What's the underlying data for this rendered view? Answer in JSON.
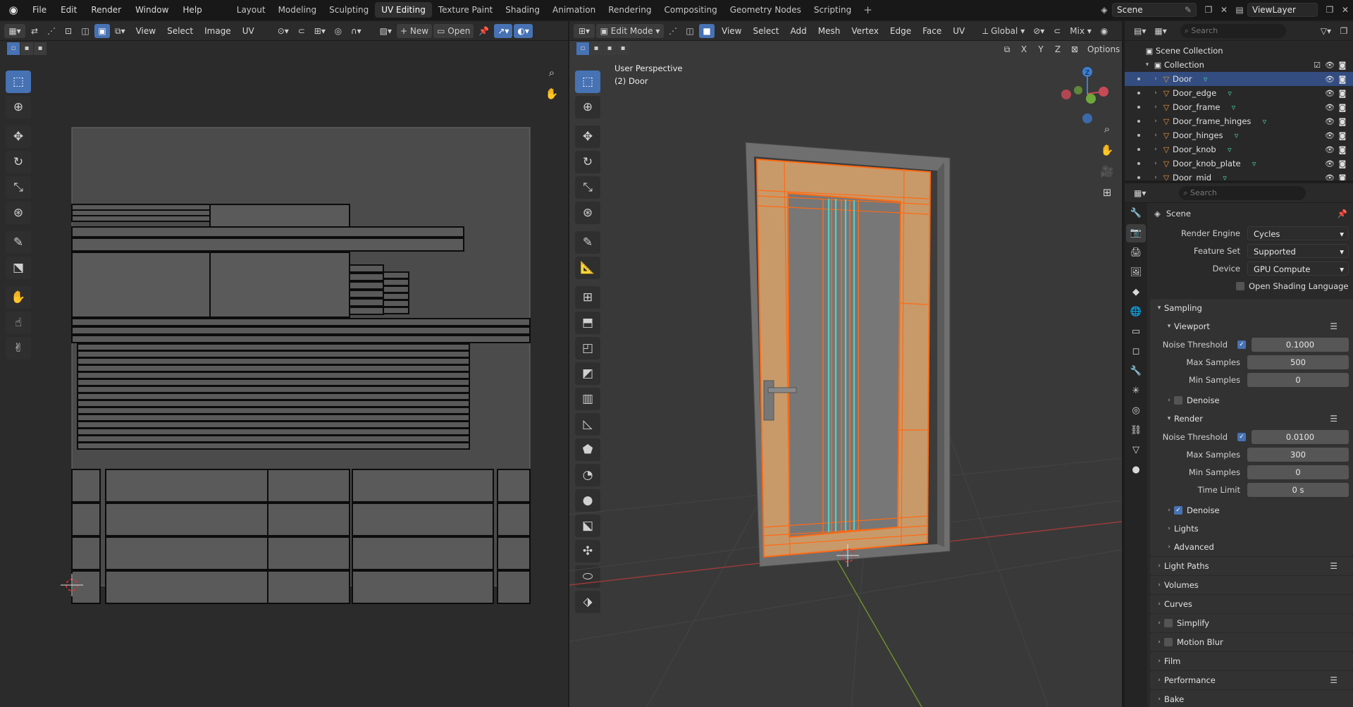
{
  "topbar": {
    "menus": [
      "File",
      "Edit",
      "Render",
      "Window",
      "Help"
    ],
    "workspaces": [
      "Layout",
      "Modeling",
      "Sculpting",
      "UV Editing",
      "Texture Paint",
      "Shading",
      "Animation",
      "Rendering",
      "Compositing",
      "Geometry Nodes",
      "Scripting"
    ],
    "active_workspace": "UV Editing",
    "scene_name": "Scene",
    "view_layer": "ViewLayer"
  },
  "uv_editor": {
    "menus": [
      "View",
      "Select",
      "Image",
      "UV"
    ],
    "new_label": "New",
    "open_label": "Open"
  },
  "viewport": {
    "mode": "Edit Mode",
    "menus": [
      "View",
      "Select",
      "Add",
      "Mesh",
      "Vertex",
      "Edge",
      "Face",
      "UV"
    ],
    "transform_orientation": "Global",
    "mix_label": "Mix",
    "options_label": "Options",
    "axis_buttons": [
      "X",
      "Y",
      "Z"
    ],
    "overlay_title": "User Perspective",
    "overlay_object": "(2) Door"
  },
  "outliner": {
    "search_placeholder": "Search",
    "scene_collection": "Scene Collection",
    "collection": "Collection",
    "objects": [
      "Door",
      "Door_edge",
      "Door_frame",
      "Door_frame_hinges",
      "Door_hinges",
      "Door_knob",
      "Door_knob_plate",
      "Door_mid"
    ]
  },
  "properties": {
    "search_placeholder": "Search",
    "context": "Scene",
    "render_engine_label": "Render Engine",
    "render_engine": "Cycles",
    "feature_set_label": "Feature Set",
    "feature_set": "Supported",
    "device_label": "Device",
    "device": "GPU Compute",
    "osl_label": "Open Shading Language",
    "sampling": "Sampling",
    "viewport": "Viewport",
    "noise_threshold_label": "Noise Threshold",
    "viewport_noise_threshold": "0.1000",
    "max_samples_label": "Max Samples",
    "viewport_max_samples": "500",
    "min_samples_label": "Min Samples",
    "viewport_min_samples": "0",
    "denoise_label": "Denoise",
    "render": "Render",
    "render_noise_threshold": "0.0100",
    "render_max_samples": "300",
    "render_min_samples": "0",
    "time_limit_label": "Time Limit",
    "time_limit": "0 s",
    "lights": "Lights",
    "advanced": "Advanced",
    "light_paths": "Light Paths",
    "volumes": "Volumes",
    "curves": "Curves",
    "simplify": "Simplify",
    "motion_blur": "Motion Blur",
    "film": "Film",
    "performance": "Performance",
    "bake": "Bake"
  },
  "colors": {
    "accent": "#4772b3",
    "selection_orange": "#ff6a13",
    "seam_cyan": "#4fd1c5",
    "wood": "#c89a6a",
    "mesh_icon": "#e8943a"
  }
}
